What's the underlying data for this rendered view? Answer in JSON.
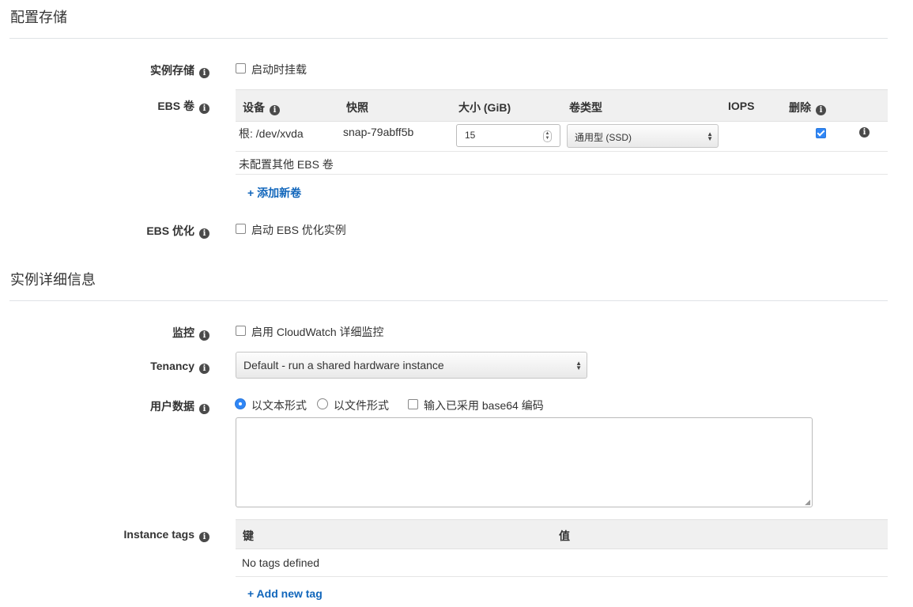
{
  "storage_section": {
    "title": "配置存储",
    "instance_store": {
      "label": "实例存储",
      "checkbox_label": "启动时挂载",
      "checked": false
    },
    "ebs_volumes": {
      "label": "EBS 卷",
      "columns": [
        "设备",
        "快照",
        "大小 (GiB)",
        "卷类型",
        "IOPS",
        "删除"
      ],
      "root_row": {
        "device": "根: /dev/xvda",
        "snapshot": "snap-79abff5b",
        "size": "15",
        "volume_type": "通用型 (SSD)",
        "iops": "",
        "delete_on_termination": true
      },
      "no_other_text": "未配置其他 EBS 卷",
      "add_link": "+ 添加新卷"
    },
    "ebs_optimized": {
      "label": "EBS 优化",
      "checkbox_label": "启动 EBS 优化实例",
      "checked": false
    }
  },
  "details_section": {
    "title": "实例详细信息",
    "monitoring": {
      "label": "监控",
      "checkbox_label": "启用 CloudWatch 详细监控",
      "checked": false
    },
    "tenancy": {
      "label": "Tenancy",
      "selected": "Default - run a shared hardware instance"
    },
    "user_data": {
      "label": "用户数据",
      "radio_text": "以文本形式",
      "radio_file": "以文件形式",
      "base64_label": "输入已采用 base64 编码",
      "selected": "text",
      "base64_checked": false,
      "value": ""
    },
    "instance_tags": {
      "label": "Instance tags",
      "columns": [
        "键",
        "值"
      ],
      "empty_text": "No tags defined",
      "add_link": "+ Add new tag"
    }
  },
  "icons": {
    "info": "info-icon",
    "info_glyph": "i"
  },
  "colors": {
    "link": "#1166bb",
    "accent": "#2f86f6",
    "header_bg": "#f0f0f0"
  }
}
